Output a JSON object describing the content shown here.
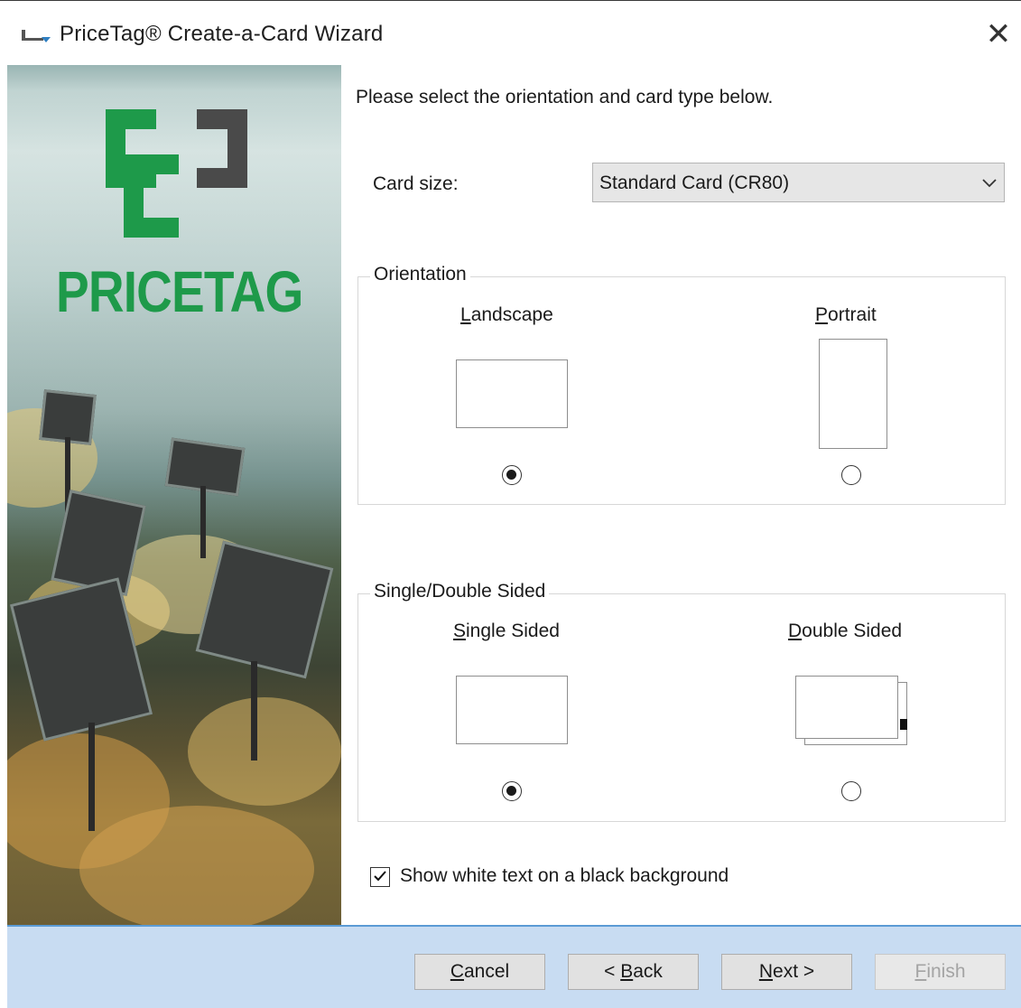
{
  "window": {
    "title": "PriceTag® Create-a-Card Wizard",
    "close_icon": "close-icon"
  },
  "banner": {
    "logo_text": "PRICETAG",
    "colors": {
      "brand_green": "#1e9a4a",
      "brand_gray": "#4a4a4a"
    }
  },
  "instruction": "Please select the orientation and card type below.",
  "card_size": {
    "label": "Card size:",
    "value": "Standard Card (CR80)"
  },
  "orientation": {
    "legend": "Orientation",
    "options": [
      {
        "mnemonic": "L",
        "rest": "andscape",
        "selected": true
      },
      {
        "mnemonic": "P",
        "rest": "ortrait",
        "selected": false
      }
    ]
  },
  "sides": {
    "legend": "Single/Double Sided",
    "options": [
      {
        "mnemonic": "S",
        "rest": "ingle Sided",
        "selected": true
      },
      {
        "mnemonic": "D",
        "rest": "ouble Sided",
        "selected": false
      }
    ]
  },
  "white_on_black": {
    "label": "Show white text on a black background",
    "checked": true
  },
  "buttons": {
    "cancel": {
      "mnemonic": "C",
      "rest": "ancel",
      "enabled": true
    },
    "back": {
      "prefix": "< ",
      "mnemonic": "B",
      "rest": "ack",
      "enabled": true
    },
    "next": {
      "mnemonic": "N",
      "rest": "ext >",
      "enabled": true
    },
    "finish": {
      "mnemonic": "F",
      "rest": "inish",
      "enabled": false
    }
  },
  "colors": {
    "footer_bg": "#c8dcf2",
    "footer_border": "#5b9bd5"
  }
}
